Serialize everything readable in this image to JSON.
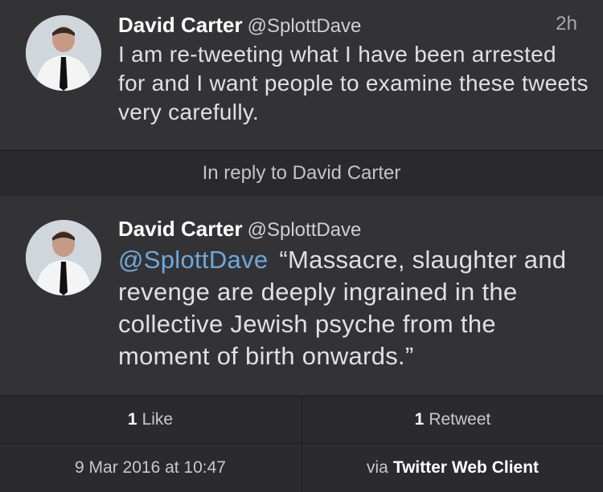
{
  "tweets": [
    {
      "name": "David Carter",
      "handle": "@SplottDave",
      "time": "2h",
      "text": "I am re-tweeting what I have been arrested for and I want people to examine these tweets very carefully."
    },
    {
      "name": "David Carter",
      "handle": "@SplottDave",
      "mention": "@SplottDave",
      "text": "“Massacre, slaughter and revenge are deeply ingrained in the collective Jewish psyche from the moment of birth onwards.”"
    }
  ],
  "reply_context": "In reply to David Carter",
  "stats": {
    "likes_count": "1",
    "likes_label": "Like",
    "retweets_count": "1",
    "retweets_label": "Retweet"
  },
  "meta": {
    "date": "9 Mar 2016 at 10:47",
    "via_prefix": "via",
    "client": "Twitter Web Client"
  },
  "colors": {
    "background": "#333335",
    "mention": "#6fa8dc",
    "text": "#e0e0e0"
  }
}
